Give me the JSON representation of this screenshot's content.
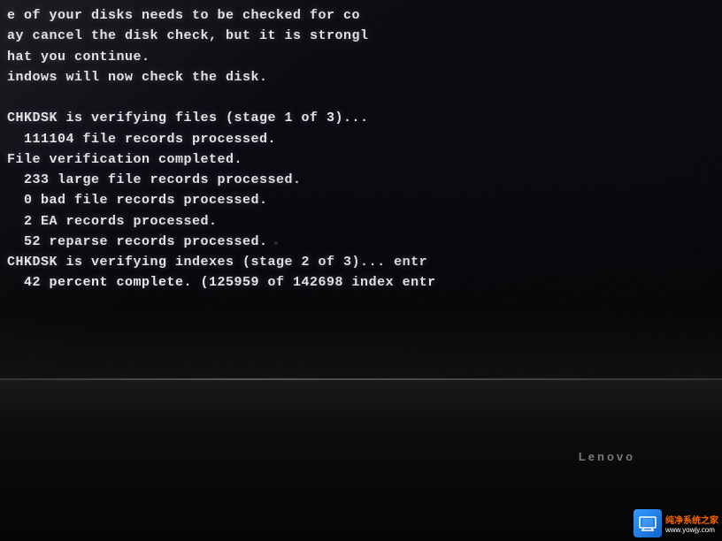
{
  "terminal": {
    "lines": [
      "e of your disks needs to be checked for co",
      "ay cancel the disk check, but it is strongl",
      "hat you continue.",
      "indows will now check the disk.",
      "",
      "CHKDSK is verifying files (stage 1 of 3)...",
      "  111104 file records processed.",
      "File verification completed.",
      "  233 large file records processed.",
      "  0 bad file records processed.",
      "  2 EA records processed.",
      "  52 reparse records processed.",
      "CHKDSK is verifying indexes (stage 2 of 3)... entr",
      "  42 percent complete. (125959 of 142698 index entr"
    ]
  },
  "lenovo": {
    "label": "Lenovo"
  },
  "watermark": {
    "line1": "纯净系统之家",
    "line2": "www.yowjy.com",
    "icon": "🖥"
  }
}
